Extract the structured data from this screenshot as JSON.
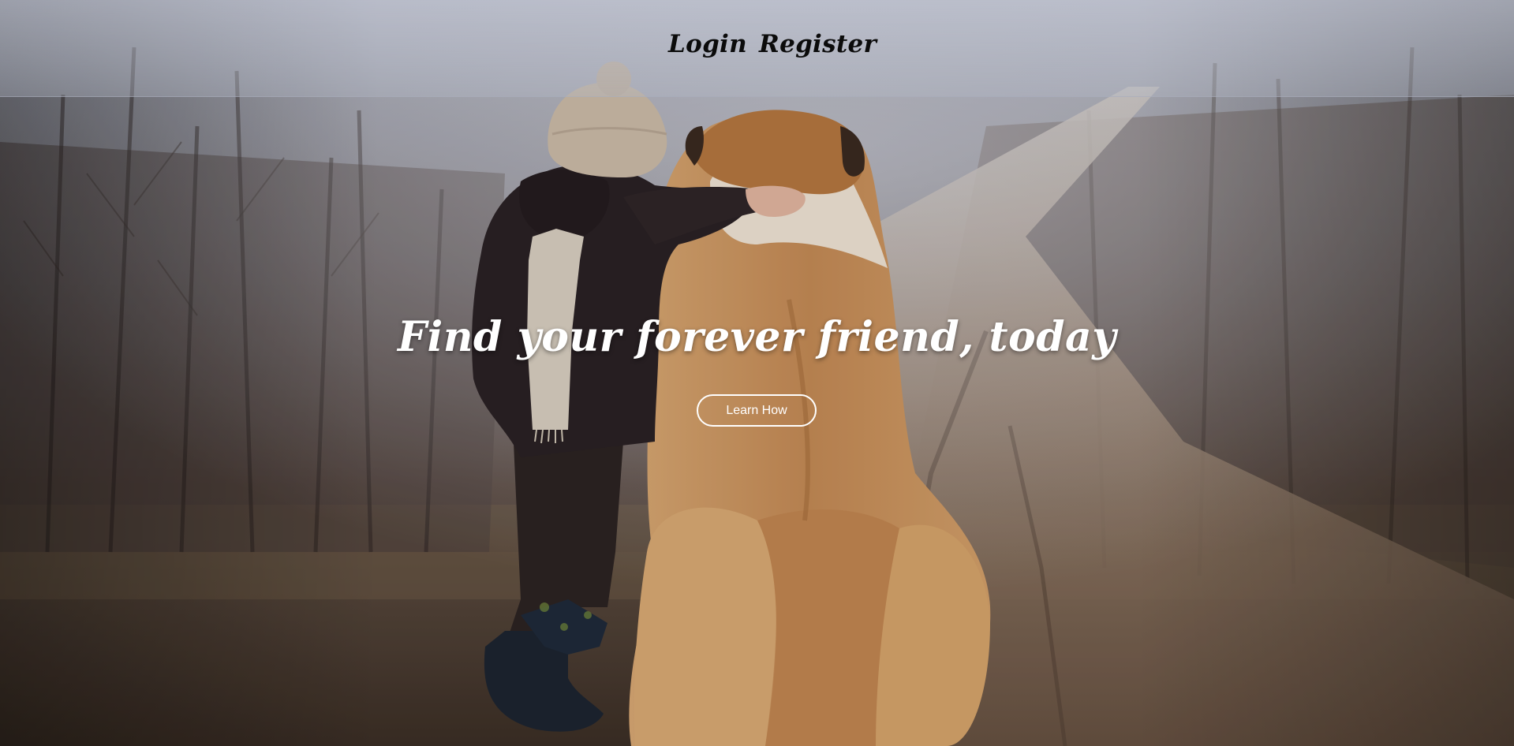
{
  "nav": {
    "login_label": "Login",
    "register_label": "Register"
  },
  "hero": {
    "title": "Find your forever friend, today",
    "button_label": "Learn How",
    "image_description": "child in knit hat and dark jacket hugging a large St. Bernard dog on a foggy dirt road"
  },
  "colors": {
    "nav_text": "#0b0b0b",
    "hero_text": "#ffffff",
    "button_border": "#ffffff"
  }
}
